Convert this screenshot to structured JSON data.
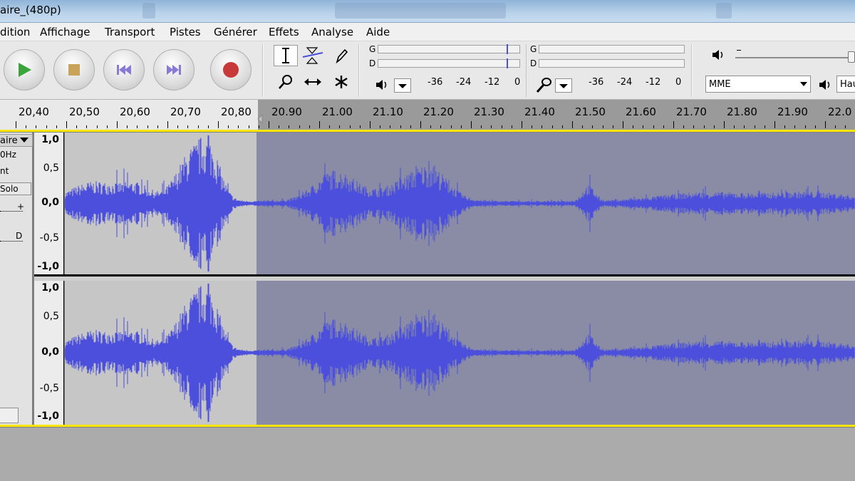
{
  "window": {
    "title": "aire_(480p)"
  },
  "menu": {
    "items": [
      "dition",
      "Affichage",
      "Transport",
      "Pistes",
      "Générer",
      "Effets",
      "Analyse",
      "Aide"
    ]
  },
  "meters": {
    "playback": {
      "left": "G",
      "right": "D"
    },
    "record": {
      "left": "G",
      "right": "D"
    },
    "scale": [
      "-36",
      "-24",
      "-12",
      "0"
    ]
  },
  "device": {
    "host": "MME",
    "output_partial": "Hau"
  },
  "ruler": {
    "ticks": [
      "20,40",
      "20,50",
      "20,60",
      "20,70",
      "20,80",
      "20.90",
      "21.00",
      "21.10",
      "21.20",
      "21.30",
      "21.40",
      "21.50",
      "21.60",
      "21.70",
      "21.80",
      "21.90",
      "22.0"
    ]
  },
  "track": {
    "name_partial": "aire",
    "rate_partial": "0Hz",
    "format_partial": "nt",
    "solo_label": "Solo",
    "gain_plus": "+",
    "pan_right": "D",
    "channels": [
      {
        "labels": [
          "1,0",
          "0,5",
          "0,0",
          "-0,5",
          "-1,0"
        ]
      },
      {
        "labels": [
          "1,0",
          "0,5",
          "0,0",
          "-0,5",
          "-1,0"
        ]
      }
    ]
  },
  "colors": {
    "waveform": "#4b4fdc",
    "selection_bg": "#8a8ca6",
    "unselected_bg": "#c6c6c6",
    "yellow_line": "#ffe600",
    "play_green": "#3aa53a",
    "record_red": "#c83a3a"
  },
  "icons": {
    "play": "play-icon",
    "stop": "stop-icon",
    "skip_start": "skip-start-icon",
    "skip_end": "skip-end-icon",
    "record": "record-icon"
  }
}
